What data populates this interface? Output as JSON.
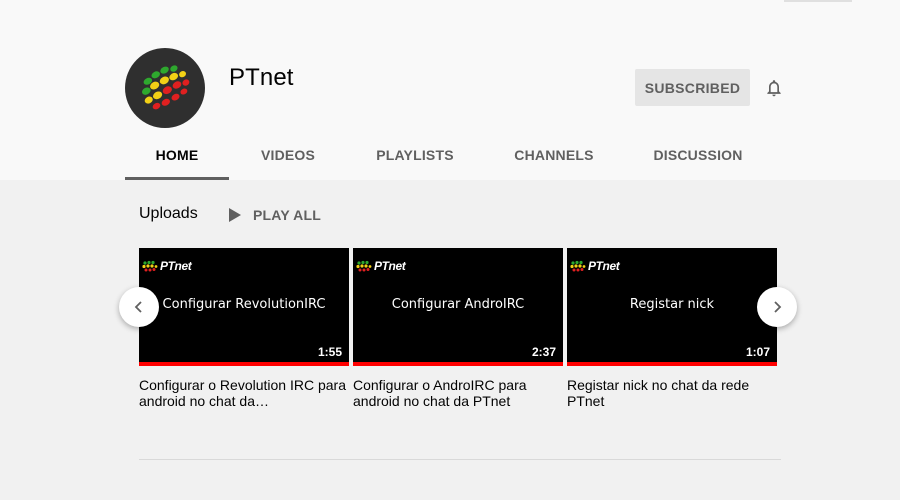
{
  "channel": {
    "name": "PTnet",
    "subscribe_label": "SUBSCRIBED",
    "icons": {
      "avatar": "ptnet-globe-logo",
      "bell": "bell-icon"
    }
  },
  "tabs": [
    {
      "label": "HOME",
      "active": true
    },
    {
      "label": "VIDEOS",
      "active": false
    },
    {
      "label": "PLAYLISTS",
      "active": false
    },
    {
      "label": "CHANNELS",
      "active": false
    },
    {
      "label": "DISCUSSION",
      "active": false
    }
  ],
  "shelf": {
    "title": "Uploads",
    "play_all_label": "PLAY ALL",
    "videos": [
      {
        "thumb_logo": "PTnet",
        "thumb_text": "Configurar RevolutionIRC",
        "duration": "1:55",
        "title": "Configurar o Revolution IRC para android no chat da…",
        "watched_fraction": 1.0
      },
      {
        "thumb_logo": "PTnet",
        "thumb_text": "Configurar AndroIRC",
        "duration": "2:37",
        "title": "Configurar o AndroIRC para android no chat da PTnet",
        "watched_fraction": 1.0
      },
      {
        "thumb_logo": "PTnet",
        "thumb_text": "Registar nick",
        "duration": "1:07",
        "title": "Registar nick no chat da rede PTnet",
        "watched_fraction": 1.0
      }
    ]
  },
  "colors": {
    "header_bg": "#f9f9f9",
    "page_bg": "#f1f1f1",
    "progress_red": "#ff0000",
    "logo_green": "#2ea82e",
    "logo_yellow": "#f2d016",
    "logo_red": "#e02020"
  }
}
